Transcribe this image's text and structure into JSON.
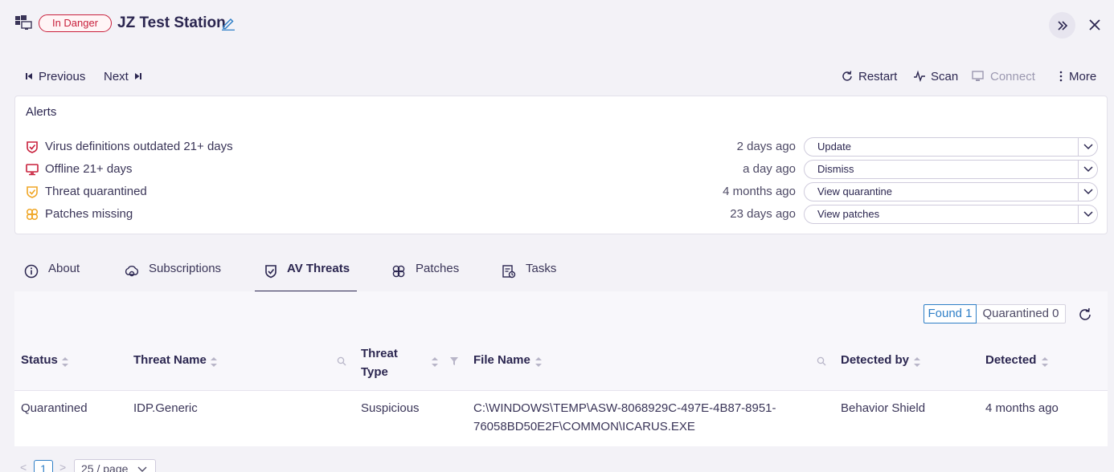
{
  "header": {
    "status_badge": "In Danger",
    "device_name": "JZ Test Station"
  },
  "nav": {
    "previous": "Previous",
    "next": "Next",
    "restart": "Restart",
    "scan": "Scan",
    "connect": "Connect",
    "more": "More"
  },
  "alerts": {
    "title": "Alerts",
    "items": [
      {
        "label": "Virus definitions outdated 21+ days",
        "time": "2 days ago",
        "action": "Update",
        "icon": "shield-alert-icon",
        "color": "#c8203c"
      },
      {
        "label": "Offline 21+ days",
        "time": "a day ago",
        "action": "Dismiss",
        "icon": "monitor-icon",
        "color": "#c8203c"
      },
      {
        "label": "Threat quarantined",
        "time": "4 months ago",
        "action": "View quarantine",
        "icon": "shield-check-icon",
        "color": "#f0a626"
      },
      {
        "label": "Patches missing",
        "time": "23 days ago",
        "action": "View patches",
        "icon": "patch-icon",
        "color": "#f0a626"
      }
    ]
  },
  "tabs": [
    {
      "label": "About",
      "icon": "info-icon"
    },
    {
      "label": "Subscriptions",
      "icon": "subscriptions-icon"
    },
    {
      "label": "AV Threats",
      "icon": "shield-check-icon"
    },
    {
      "label": "Patches",
      "icon": "patch-icon"
    },
    {
      "label": "Tasks",
      "icon": "tasks-icon"
    }
  ],
  "threats": {
    "found_label": "Found 1",
    "quarantined_label": "Quarantined 0",
    "columns": {
      "status": "Status",
      "threat_name": "Threat Name",
      "threat_type_1": "Threat",
      "threat_type_2": "Type",
      "file_name": "File Name",
      "detected_by": "Detected by",
      "detected": "Detected"
    },
    "rows": [
      {
        "status": "Quarantined",
        "threat_name": "IDP.Generic",
        "threat_type": "Suspicious",
        "file_name_1": "C:\\WINDOWS\\TEMP\\ASW-8068929C-497E-4B87-8951-",
        "file_name_2": "76058BD50E2F\\COMMON\\ICARUS.EXE",
        "detected_by": "Behavior Shield",
        "detected": "4 months ago"
      }
    ]
  },
  "pagination": {
    "prev": "<",
    "page": "1",
    "next": ">",
    "page_size": "25 / page"
  },
  "colors": {
    "danger": "#c8203c",
    "warning": "#f0a626",
    "accent": "#2f7fc7",
    "text": "#2b2650"
  }
}
